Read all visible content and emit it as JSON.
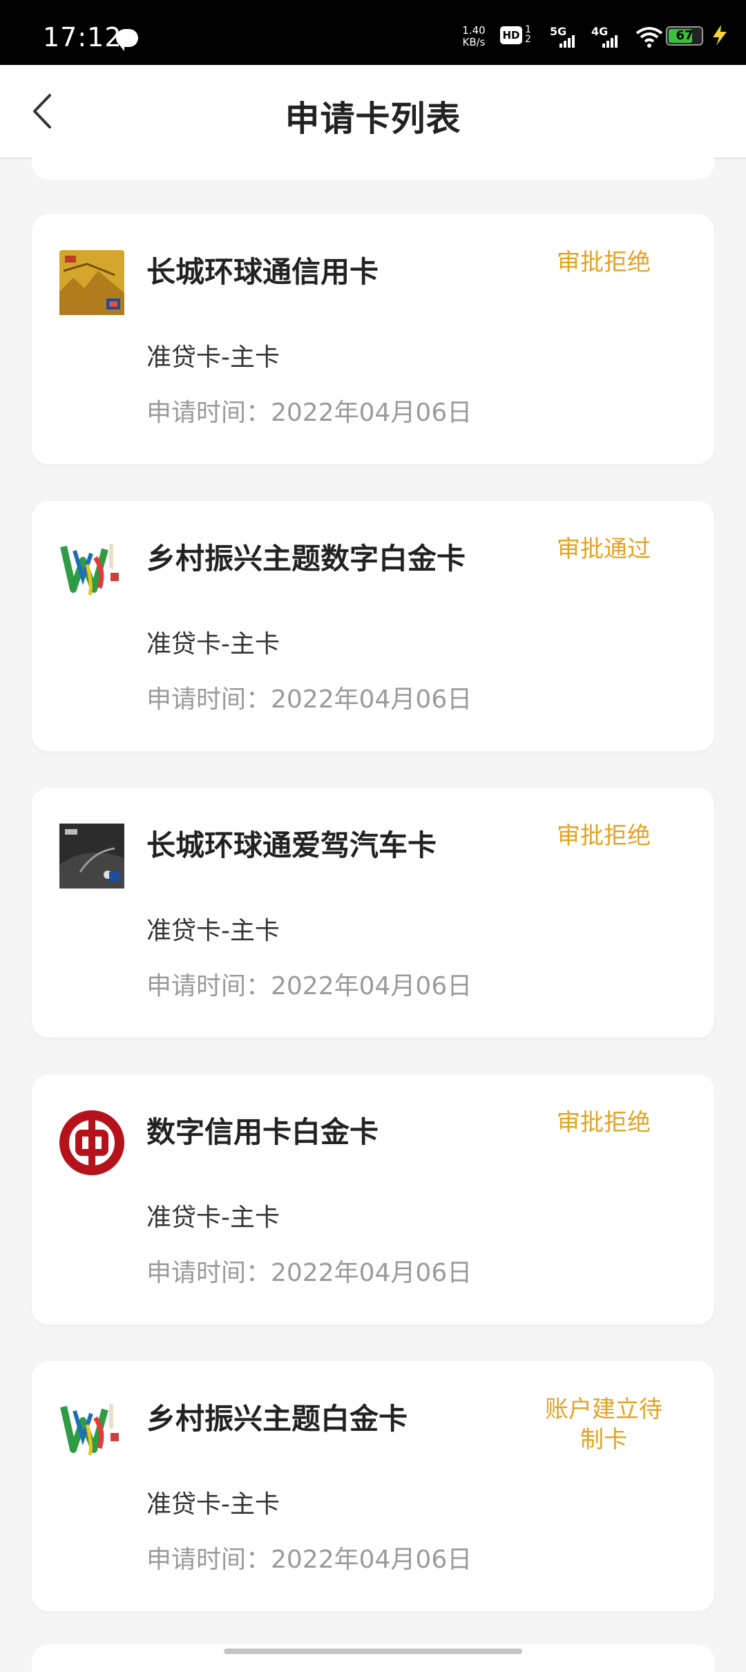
{
  "status_bar": {
    "time": "17:12",
    "speed_value": "1.40",
    "speed_unit": "KB/s",
    "hd_label": "HD",
    "hd_sub1": "1",
    "hd_sub2": "2",
    "net1": "5G",
    "net2": "4G",
    "battery": "67"
  },
  "header": {
    "title": "申请卡列表",
    "back_icon": "chevron-left-icon"
  },
  "cards": [
    {
      "name": "长城环球通信用卡",
      "status": "审批拒绝",
      "type": "准贷卡-主卡",
      "date": "申请时间：2022年04月06日",
      "image": "great-wall-gold-card"
    },
    {
      "name": "乡村振兴主题数字白金卡",
      "status": "审批通过",
      "type": "准贷卡-主卡",
      "date": "申请时间：2022年04月06日",
      "image": "rural-revitalization-card"
    },
    {
      "name": "长城环球通爱驾汽车卡",
      "status": "审批拒绝",
      "type": "准贷卡-主卡",
      "date": "申请时间：2022年04月06日",
      "image": "car-card"
    },
    {
      "name": "数字信用卡白金卡",
      "status": "审批拒绝",
      "type": "准贷卡-主卡",
      "date": "申请时间：2022年04月06日",
      "image": "bank-of-china-logo"
    },
    {
      "name": "乡村振兴主题白金卡",
      "status": "账户建立待制卡",
      "type": "准贷卡-主卡",
      "date": "申请时间：2022年04月06日",
      "image": "rural-revitalization-card"
    }
  ],
  "colors": {
    "status": "#e3a323",
    "title": "#222222",
    "date": "#9a9a9a",
    "background": "#f5f5f5"
  }
}
